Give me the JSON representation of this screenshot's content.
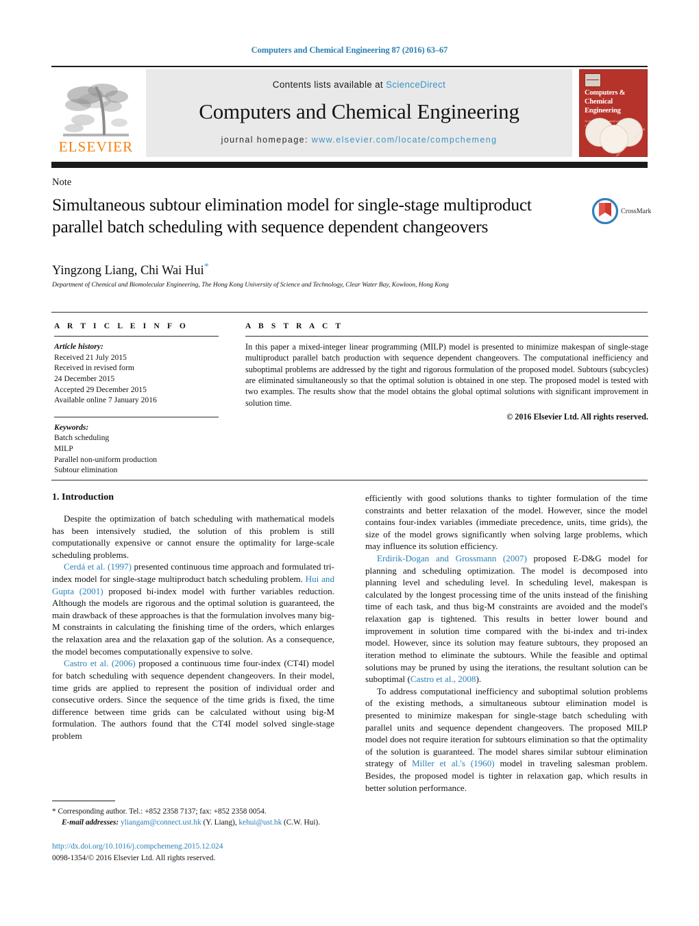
{
  "running_head": "Computers and Chemical Engineering 87 (2016) 63–67",
  "masthead": {
    "contents_prefix": "Contents lists available at ",
    "sciencedirect": "ScienceDirect",
    "journal_title": "Computers and Chemical Engineering",
    "homepage_prefix": "journal homepage: ",
    "homepage_url": "www.elsevier.com/locate/compchemeng",
    "publisher": "ELSEVIER",
    "cover": {
      "title": "Computers & Chemical Engineering",
      "subtitle": "An International Journal of Computer Applications in Chemical Engineering",
      "spine_text": "Computers and Chemical Engineering"
    },
    "accent_orange": "#f2820b",
    "link_blue": "#3a94c8",
    "band_gray": "#e9e9e9"
  },
  "article": {
    "type_label": "Note",
    "title": "Simultaneous subtour elimination model for single-stage multiproduct parallel batch scheduling with sequence dependent changeovers",
    "authors": "Yingzong Liang, Chi Wai Hui",
    "corresponding_marker": "*",
    "affiliation": "Department of Chemical and Biomolecular Engineering, The Hong Kong University of Science and Technology, Clear Water Bay, Kowloon, Hong Kong",
    "crossmark_label": "CrossMark"
  },
  "article_info": {
    "heading": "A R T I C L E   I N F O",
    "history_label": "Article history:",
    "history": [
      "Received 21 July 2015",
      "Received in revised form",
      "24 December 2015",
      "Accepted 29 December 2015",
      "Available online 7 January 2016"
    ],
    "keywords_label": "Keywords:",
    "keywords": [
      "Batch scheduling",
      "MILP",
      "Parallel non-uniform production",
      "Subtour elimination"
    ]
  },
  "abstract": {
    "heading": "A B S T R A C T",
    "text": "In this paper a mixed-integer linear programming (MILP) model is presented to minimize makespan of single-stage multiproduct parallel batch production with sequence dependent changeovers. The computational inefficiency and suboptimal problems are addressed by the tight and rigorous formulation of the proposed model. Subtours (subcycles) are eliminated simultaneously so that the optimal solution is obtained in one step. The proposed model is tested with two examples. The results show that the model obtains the global optimal solutions with significant improvement in solution time.",
    "copyright": "© 2016 Elsevier Ltd. All rights reserved."
  },
  "body": {
    "section_number_title": "1.  Introduction",
    "left_paragraphs": [
      {
        "segments": [
          {
            "t": "Despite the optimization of batch scheduling with mathematical models has been intensively studied, the solution of this problem is still computationally expensive or cannot ensure the optimality for large-scale scheduling problems.",
            "ref": false
          }
        ]
      },
      {
        "segments": [
          {
            "t": "Cerdá et al. (1997)",
            "ref": true
          },
          {
            "t": " presented continuous time approach and formulated tri-index model for single-stage multiproduct batch scheduling problem. ",
            "ref": false
          },
          {
            "t": "Hui and Gupta (2001)",
            "ref": true
          },
          {
            "t": " proposed bi-index model with further variables reduction. Although the models are rigorous and the optimal solution is guaranteed, the main drawback of these approaches is that the formulation involves many big-M constraints in calculating the finishing time of the orders, which enlarges the relaxation area and the relaxation gap of the solution. As a consequence, the model becomes computationally expensive to solve.",
            "ref": false
          }
        ]
      },
      {
        "segments": [
          {
            "t": "Castro et al. (2006)",
            "ref": true
          },
          {
            "t": " proposed a continuous time four-index (CT4I) model for batch scheduling with sequence dependent changeovers. In their model, time grids are applied to represent the position of individual order and consecutive orders. Since the sequence of the time grids is fixed, the time difference between time grids can be calculated without using big-M formulation. The authors found that the CT4I model solved single-stage problem",
            "ref": false
          }
        ]
      }
    ],
    "right_paragraphs": [
      {
        "segments": [
          {
            "t": "efficiently with good solutions thanks to tighter formulation of the time constraints and better relaxation of the model. However, since the model contains four-index variables (immediate precedence, units, time grids), the size of the model grows significantly when solving large problems, which may influence its solution efficiency.",
            "ref": false
          }
        ],
        "indent": false
      },
      {
        "segments": [
          {
            "t": "Erdirik-Dogan and Grossmann (2007)",
            "ref": true
          },
          {
            "t": " proposed E-D&G model for planning and scheduling optimization. The model is decomposed into planning level and scheduling level. In scheduling level, makespan is calculated by the longest processing time of the units instead of the finishing time of each task, and thus big-M constraints are avoided and the model's relaxation gap is tightened. This results in better lower bound and improvement in solution time compared with the bi-index and tri-index model. However, since its solution may feature subtours, they proposed an iteration method to eliminate the subtours. While the feasible and optimal solutions may be pruned by using the iterations, the resultant solution can be suboptimal (",
            "ref": false
          },
          {
            "t": "Castro et al., 2008",
            "ref": true
          },
          {
            "t": ").",
            "ref": false
          }
        ],
        "indent": true
      },
      {
        "segments": [
          {
            "t": "To address computational inefficiency and suboptimal solution problems of the existing methods, a simultaneous subtour elimination model is presented to minimize makespan for single-stage batch scheduling with parallel units and sequence dependent changeovers. The proposed MILP model does not require iteration for subtours elimination so that the optimality of the solution is guaranteed. The model shares similar subtour elimination strategy of ",
            "ref": false
          },
          {
            "t": "Miller et al.'s (1960)",
            "ref": true
          },
          {
            "t": " model in traveling salesman problem. Besides, the proposed model is tighter in relaxation gap, which results in better solution performance.",
            "ref": false
          }
        ],
        "indent": true
      }
    ]
  },
  "footnote": {
    "marker": "*",
    "corresponding": "Corresponding author. Tel.: +852 2358 7137; fax: +852 2358 0054.",
    "email_label": "E-mail addresses:",
    "email1": "yliangam@connect.ust.hk",
    "email1_name": "(Y. Liang),",
    "email2": "kehui@ust.hk",
    "email2_name": "(C.W. Hui)."
  },
  "doi_block": {
    "doi": "http://dx.doi.org/10.1016/j.compchemeng.2015.12.024",
    "issn_line": "0098-1354/© 2016 Elsevier Ltd. All rights reserved."
  }
}
